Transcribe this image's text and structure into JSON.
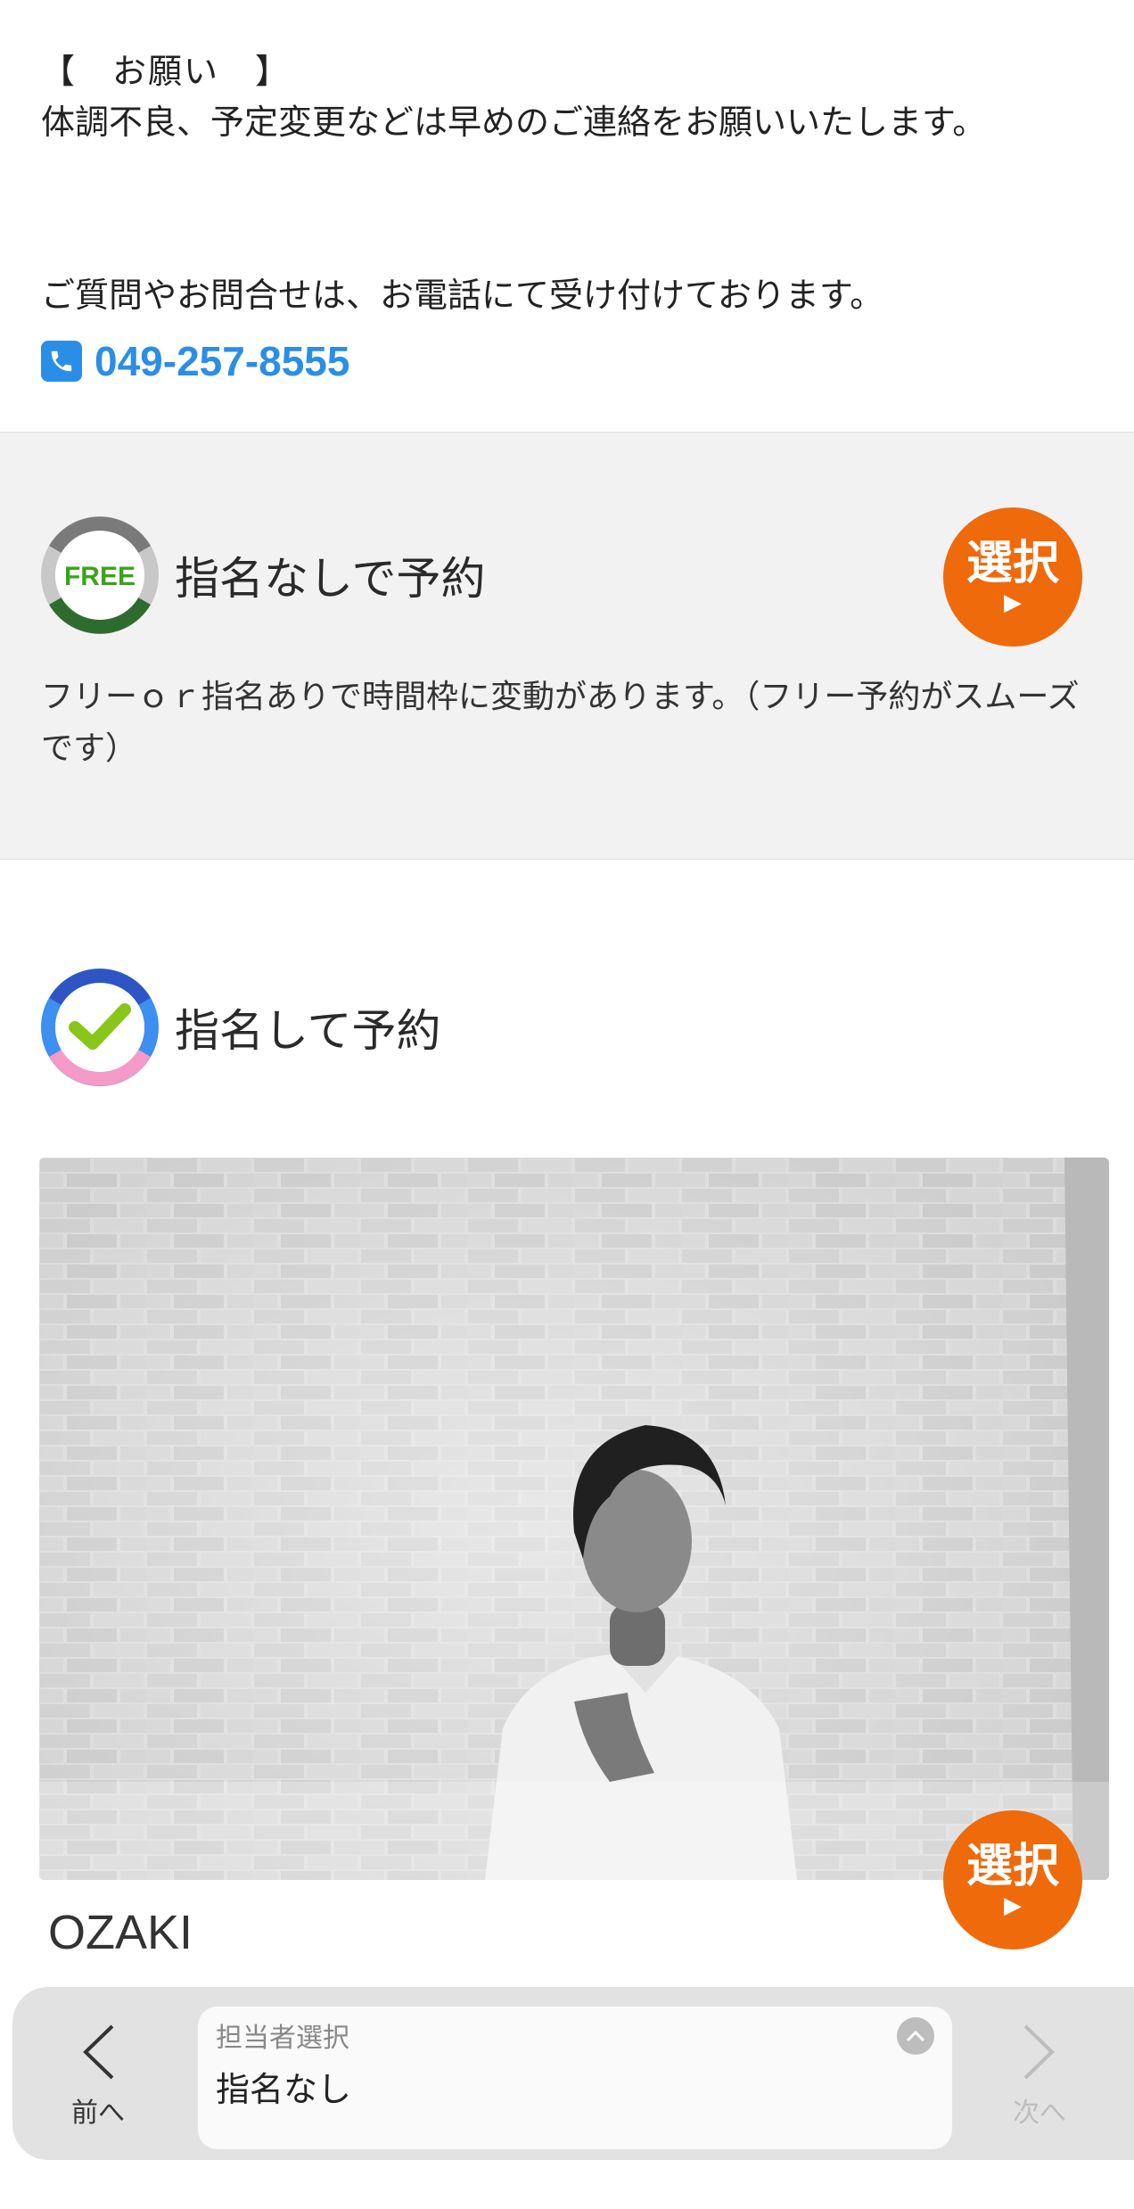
{
  "notice": {
    "title": "【　お願い　】",
    "body": "体調不良、予定変更などは早めのご連絡をお願いいたします。"
  },
  "contact": {
    "question_text": "ご質問やお問合せは、お電話にて受け付けております。",
    "phone": "049-257-8555"
  },
  "free_reservation": {
    "badge_text": "FREE",
    "title": "指名なしで予約",
    "button_label": "選択",
    "button_arrow": "▶",
    "description": "フリーｏｒ指名ありで時間枠に変動があります。（フリー予約がスムーズです）"
  },
  "designated_reservation": {
    "title": "指名して予約"
  },
  "staff": [
    {
      "name": "OZAKI",
      "button_label": "選択",
      "button_arrow": "▶"
    }
  ],
  "bottom_bar": {
    "prev_label": "前へ",
    "next_label": "次へ",
    "select_caption": "担当者選択",
    "select_value": "指名なし"
  },
  "colors": {
    "accent_orange": "#ef6a0b",
    "phone_blue": "#2b8ee6",
    "free_green": "#3aa31a",
    "free_dark_green": "#2e6b2e"
  }
}
